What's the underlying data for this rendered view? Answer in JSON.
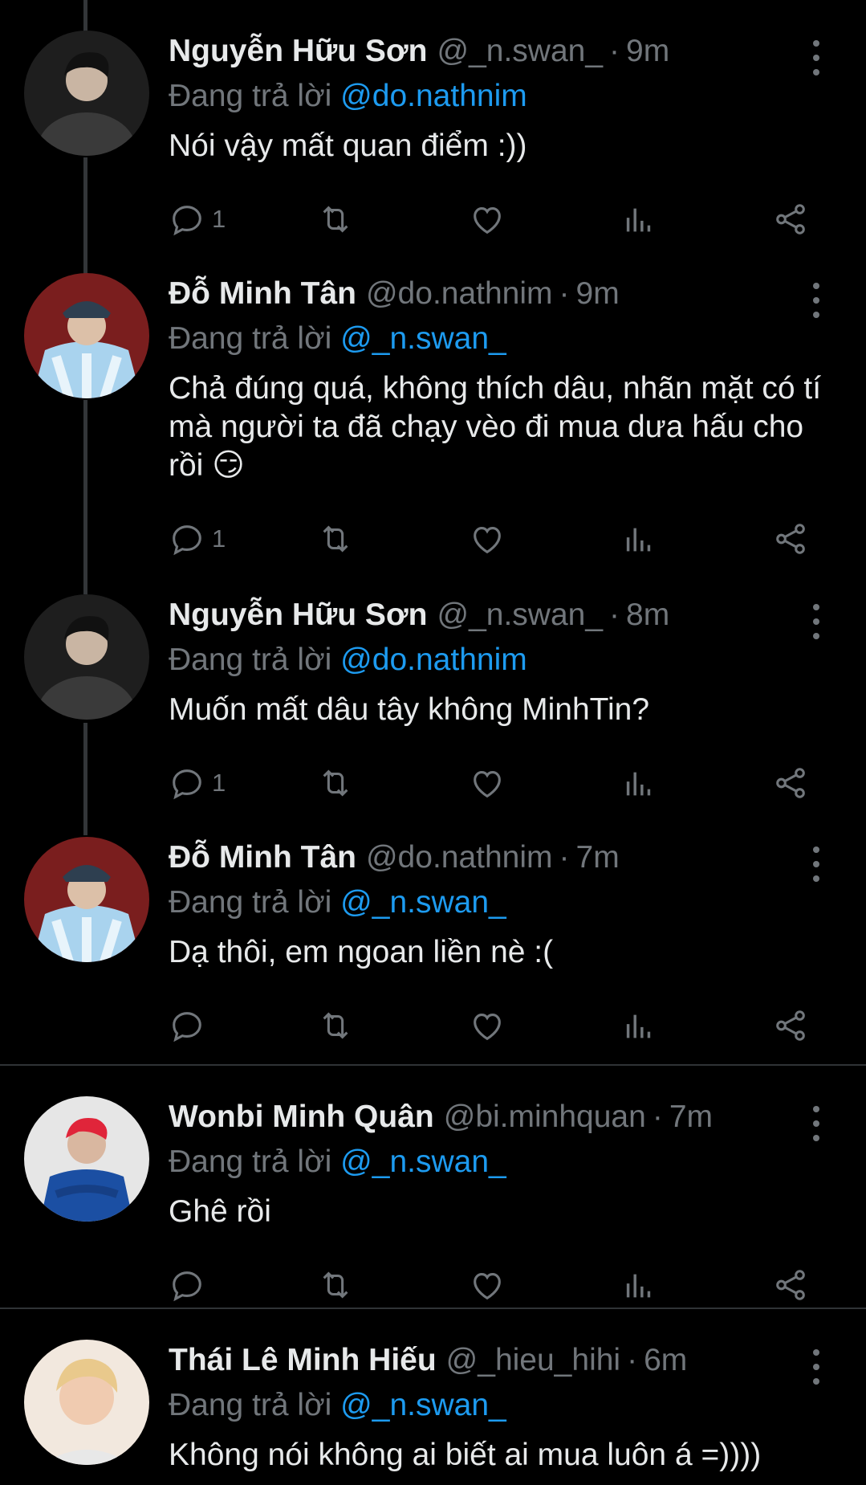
{
  "replying_label": "Đang trả lời",
  "tweets": [
    {
      "name": "Nguyễn Hữu Sơn",
      "handle": "@_n.swan_",
      "separator": "·",
      "time": "9m",
      "replying_to": "@do.nathnim",
      "text": "Nói vậy mất quan điểm :))",
      "reply_count": "1"
    },
    {
      "name": "Đỗ Minh Tân",
      "handle": "@do.nathnim",
      "separator": "·",
      "time": "9m",
      "replying_to": "@_n.swan_",
      "text": "Chả đúng quá, không thích dâu, nhãn mặt có tí mà người ta đã chạy vèo đi mua dưa hấu cho rồi 😏",
      "reply_count": "1"
    },
    {
      "name": "Nguyễn Hữu Sơn",
      "handle": "@_n.swan_",
      "separator": "·",
      "time": "8m",
      "replying_to": "@do.nathnim",
      "text": "Muốn mất dâu tây không MinhTin?",
      "reply_count": "1"
    },
    {
      "name": "Đỗ Minh Tân",
      "handle": "@do.nathnim",
      "separator": "·",
      "time": "7m",
      "replying_to": "@_n.swan_",
      "text": "Dạ thôi, em ngoan liền nè :(",
      "reply_count": ""
    },
    {
      "name": "Wonbi Minh Quân",
      "handle": "@bi.minhquan",
      "separator": "·",
      "time": "7m",
      "replying_to": "@_n.swan_",
      "text": "Ghê rồi",
      "reply_count": ""
    },
    {
      "name": "Thái Lê Minh Hiếu",
      "handle": "@_hieu_hihi",
      "separator": "·",
      "time": "6m",
      "replying_to": "@_n.swan_",
      "text": "Không nói không ai biết ai mua luôn á =))))",
      "reply_count": ""
    }
  ],
  "icons": {
    "reply": "reply-icon",
    "retweet": "retweet-icon",
    "like": "like-icon",
    "views": "views-icon",
    "share": "share-icon",
    "more": "more-icon"
  },
  "colors": {
    "background": "#000000",
    "text": "#e7e9ea",
    "secondary": "#71767b",
    "link": "#1d9bf0",
    "divider": "#2f3336"
  }
}
